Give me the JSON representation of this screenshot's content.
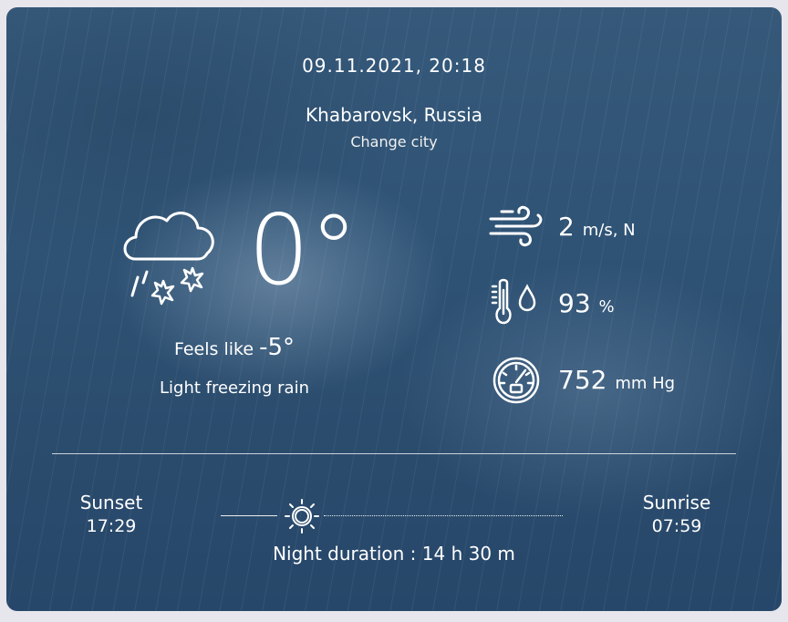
{
  "header": {
    "datetime": "09.11.2021, 20:18",
    "city": "Khabarovsk, Russia",
    "change_city": "Change city"
  },
  "current": {
    "temperature": "0°",
    "feels_like_label": "Feels like",
    "feels_like_value": "-5°",
    "description": "Light freezing rain",
    "icon": "cloud-rain-snow-icon"
  },
  "stats": {
    "wind": {
      "value": "2",
      "unit": "m/s, N",
      "icon": "wind-icon"
    },
    "humidity": {
      "value": "93",
      "unit": "%",
      "icon": "thermometer-drop-icon"
    },
    "pressure": {
      "value": "752",
      "unit": "mm Hg",
      "icon": "barometer-icon"
    }
  },
  "sun": {
    "sunset_label": "Sunset",
    "sunset_time": "17:29",
    "sunrise_label": "Sunrise",
    "sunrise_time": "07:59",
    "night_duration": "Night duration : 14 h 30 m",
    "icon": "sun-icon"
  },
  "colors": {
    "text": "#ffffff",
    "background": "#2f5375"
  }
}
